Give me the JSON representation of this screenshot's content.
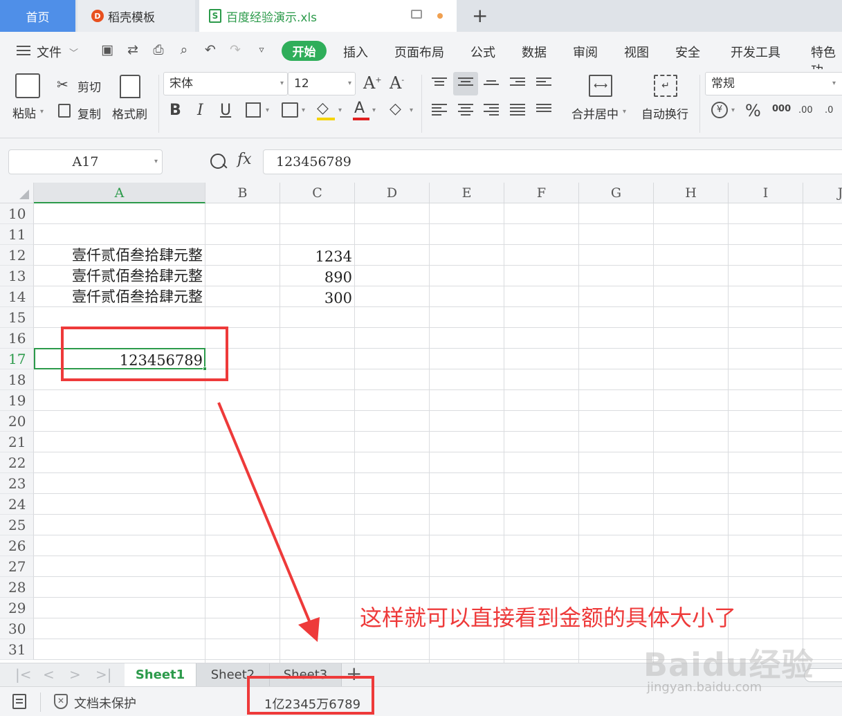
{
  "tabs": {
    "home": "首页",
    "templates": "稻壳模板",
    "file": "百度经验演示.xls"
  },
  "menu": {
    "file": "文件",
    "start": "开始",
    "insert": "插入",
    "page_layout": "页面布局",
    "formula": "公式",
    "data": "数据",
    "review": "审阅",
    "view": "视图",
    "security": "安全",
    "dev_tools": "开发工具",
    "special": "特色功"
  },
  "ribbon": {
    "paste": "粘贴",
    "cut": "剪切",
    "copy": "复制",
    "format_painter": "格式刷",
    "font_name": "宋体",
    "font_size": "12",
    "merge_center": "合并居中",
    "wrap_text": "自动换行",
    "number_format": "常规",
    "percent": "%",
    "thousands": "000",
    "inc_decimal": ".00",
    "dec_decimal": ".0"
  },
  "formula_bar": {
    "name_box": "A17",
    "fx": "fx",
    "value": "123456789"
  },
  "grid": {
    "columns": [
      "A",
      "B",
      "C",
      "D",
      "E",
      "F",
      "G",
      "H",
      "I",
      "J"
    ],
    "rows": [
      "10",
      "11",
      "12",
      "13",
      "14",
      "15",
      "16",
      "17",
      "18",
      "19",
      "20",
      "21",
      "22",
      "23",
      "24",
      "25",
      "26",
      "27",
      "28",
      "29",
      "30",
      "31"
    ],
    "active_row": "17",
    "cells": {
      "A12": "壹仟贰佰叁拾肆元整",
      "A13": "壹仟贰佰叁拾肆元整",
      "A14": "壹仟贰佰叁拾肆元整",
      "C12": "1234",
      "C13": "890",
      "C14": "300",
      "A17": "123456789"
    }
  },
  "sheets": [
    "Sheet1",
    "Sheet2",
    "Sheet3"
  ],
  "active_sheet": "Sheet1",
  "status": {
    "protection": "文档未保护",
    "value_display": "1亿2345万6789"
  },
  "annotation": {
    "text": "这样就可以直接看到金额的具体大小了",
    "color": "#ee3a3a"
  },
  "watermark": {
    "logo": "Baidu经验",
    "url": "jingyan.baidu.com"
  },
  "colors": {
    "accent_green": "#2b9a4a",
    "home_tab_blue": "#4f8fe8",
    "start_button": "#2fae5a"
  }
}
